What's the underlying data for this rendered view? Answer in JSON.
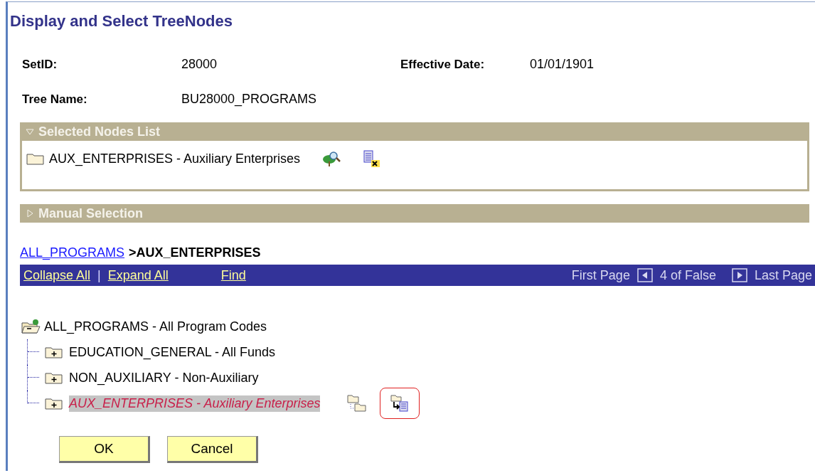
{
  "title": "Display and Select TreeNodes",
  "fields": [
    {
      "label": "SetID:",
      "value": "28000"
    },
    {
      "label": "Effective Date:",
      "value": "01/01/1901"
    },
    {
      "label": "Tree Name:",
      "value": "BU28000_PROGRAMS"
    }
  ],
  "sections": [
    {
      "title": "Selected Nodes List",
      "expanded": true,
      "items": [
        {
          "text": "AUX_ENTERPRISES - Auxiliary Enterprises"
        }
      ]
    },
    {
      "title": "Manual Selection",
      "expanded": false
    }
  ],
  "breadcrumb": {
    "link": "ALL_PROGRAMS",
    "current": ">AUX_ENTERPRISES"
  },
  "navbar": {
    "links": [
      "Collapse All",
      "Expand All"
    ],
    "separator": "|",
    "find": "Find",
    "first_page": "First Page",
    "counter": "4 of False",
    "last_page": "Last Page"
  },
  "tree": {
    "text": "ALL_PROGRAMS - All Program Codes",
    "children": [
      {
        "text": "EDUCATION_GENERAL - All Funds",
        "selected": false
      },
      {
        "text": "NON_AUXILIARY - Non-Auxiliary",
        "selected": false
      },
      {
        "text": "AUX_ENTERPRISES - Auxiliary Enterprises",
        "selected": true
      }
    ]
  },
  "buttons": [
    "OK",
    "Cancel"
  ]
}
